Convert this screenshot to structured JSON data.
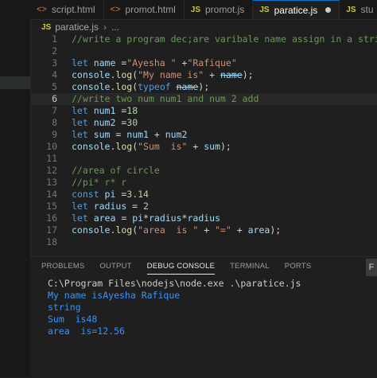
{
  "tabs": [
    {
      "label": "script.html",
      "icon": "html-icon",
      "active": false
    },
    {
      "label": "promot.html",
      "icon": "html-icon",
      "active": false
    },
    {
      "label": "promot.js",
      "icon": "js-icon",
      "active": false
    },
    {
      "label": "paratice.js",
      "icon": "js-icon",
      "active": true,
      "unsaved": true
    },
    {
      "label": "stu",
      "icon": "js-icon",
      "active": false
    }
  ],
  "breadcrumb": {
    "file": "paratice.js",
    "more": "..."
  },
  "editor": {
    "current_line": 6,
    "lines": [
      {
        "n": "1",
        "tokens": [
          {
            "t": "//write a program dec;are varibale name assign in a string",
            "c": "cm"
          }
        ]
      },
      {
        "n": "2",
        "tokens": []
      },
      {
        "n": "3",
        "tokens": [
          {
            "t": "let ",
            "c": "kw"
          },
          {
            "t": "name",
            "c": "vr"
          },
          {
            "t": " =",
            "c": "pl"
          },
          {
            "t": "\"Ayesha \"",
            "c": "st"
          },
          {
            "t": " +",
            "c": "pl"
          },
          {
            "t": "\"Rafique\"",
            "c": "st"
          }
        ]
      },
      {
        "n": "4",
        "tokens": [
          {
            "t": "console",
            "c": "vr"
          },
          {
            "t": ".",
            "c": "pl"
          },
          {
            "t": "log",
            "c": "fn"
          },
          {
            "t": "(",
            "c": "pl"
          },
          {
            "t": "\"My name is\"",
            "c": "st"
          },
          {
            "t": " + ",
            "c": "pl"
          },
          {
            "t": "name",
            "c": "vr",
            "s": true
          },
          {
            "t": ");",
            "c": "pl"
          }
        ]
      },
      {
        "n": "5",
        "tokens": [
          {
            "t": "console",
            "c": "vr"
          },
          {
            "t": ".",
            "c": "pl"
          },
          {
            "t": "log",
            "c": "fn"
          },
          {
            "t": "(",
            "c": "pl"
          },
          {
            "t": "typeof ",
            "c": "kw"
          },
          {
            "t": "name",
            "c": "vr",
            "s": true
          },
          {
            "t": ");",
            "c": "pl"
          }
        ]
      },
      {
        "n": "6",
        "tokens": [
          {
            "t": "//write two num num1 and num 2 add",
            "c": "cm"
          }
        ]
      },
      {
        "n": "7",
        "tokens": [
          {
            "t": "let ",
            "c": "kw"
          },
          {
            "t": "num1",
            "c": "vr"
          },
          {
            "t": " =",
            "c": "pl"
          },
          {
            "t": "18",
            "c": "nu"
          }
        ]
      },
      {
        "n": "8",
        "tokens": [
          {
            "t": "let ",
            "c": "kw"
          },
          {
            "t": "num2",
            "c": "vr"
          },
          {
            "t": " =",
            "c": "pl"
          },
          {
            "t": "30",
            "c": "nu"
          }
        ]
      },
      {
        "n": "9",
        "tokens": [
          {
            "t": "let ",
            "c": "kw"
          },
          {
            "t": "sum",
            "c": "vr"
          },
          {
            "t": " = ",
            "c": "pl"
          },
          {
            "t": "num1",
            "c": "vr"
          },
          {
            "t": " + ",
            "c": "pl"
          },
          {
            "t": "num2",
            "c": "vr"
          }
        ]
      },
      {
        "n": "10",
        "tokens": [
          {
            "t": "console",
            "c": "vr"
          },
          {
            "t": ".",
            "c": "pl"
          },
          {
            "t": "log",
            "c": "fn"
          },
          {
            "t": "(",
            "c": "pl"
          },
          {
            "t": "\"Sum  is\"",
            "c": "st"
          },
          {
            "t": " + ",
            "c": "pl"
          },
          {
            "t": "sum",
            "c": "vr"
          },
          {
            "t": ");",
            "c": "pl"
          }
        ]
      },
      {
        "n": "11",
        "tokens": []
      },
      {
        "n": "12",
        "tokens": [
          {
            "t": "//area of circle",
            "c": "cm"
          }
        ]
      },
      {
        "n": "13",
        "tokens": [
          {
            "t": "//pi* r* r",
            "c": "cm"
          }
        ]
      },
      {
        "n": "14",
        "tokens": [
          {
            "t": "const ",
            "c": "kw"
          },
          {
            "t": "pi",
            "c": "vr"
          },
          {
            "t": " =",
            "c": "pl"
          },
          {
            "t": "3.14",
            "c": "nu"
          }
        ]
      },
      {
        "n": "15",
        "tokens": [
          {
            "t": "let ",
            "c": "kw"
          },
          {
            "t": "radius",
            "c": "vr"
          },
          {
            "t": " = ",
            "c": "pl"
          },
          {
            "t": "2",
            "c": "nu"
          }
        ]
      },
      {
        "n": "16",
        "tokens": [
          {
            "t": "let ",
            "c": "kw"
          },
          {
            "t": "area",
            "c": "vr"
          },
          {
            "t": " = ",
            "c": "pl"
          },
          {
            "t": "pi",
            "c": "vr"
          },
          {
            "t": "*",
            "c": "pl"
          },
          {
            "t": "radius",
            "c": "vr"
          },
          {
            "t": "*",
            "c": "pl"
          },
          {
            "t": "radius",
            "c": "vr"
          }
        ]
      },
      {
        "n": "17",
        "tokens": [
          {
            "t": "console",
            "c": "vr"
          },
          {
            "t": ".",
            "c": "pl"
          },
          {
            "t": "log",
            "c": "fn"
          },
          {
            "t": "(",
            "c": "pl"
          },
          {
            "t": "\"area  is \"",
            "c": "st"
          },
          {
            "t": " + ",
            "c": "pl"
          },
          {
            "t": "\"=\"",
            "c": "st"
          },
          {
            "t": " + ",
            "c": "pl"
          },
          {
            "t": "area",
            "c": "vr"
          },
          {
            "t": ");",
            "c": "pl"
          }
        ]
      },
      {
        "n": "18",
        "tokens": []
      }
    ]
  },
  "panel": {
    "tabs": [
      "PROBLEMS",
      "OUTPUT",
      "DEBUG CONSOLE",
      "TERMINAL",
      "PORTS"
    ],
    "active_tab": "DEBUG CONSOLE",
    "filter_label": "F",
    "command": "C:\\Program Files\\nodejs\\node.exe .\\paratice.js",
    "output": [
      "My name isAyesha Rafique",
      "string",
      "Sum  is48",
      "area  is=12.56"
    ]
  },
  "colors": {
    "keyword": "#569cd6",
    "variable": "#9cdcfe",
    "string": "#ce9178",
    "function": "#dcdcaa",
    "comment": "#6a9955",
    "number": "#b5cea8",
    "output": "#3794ff",
    "accent": "#0078d4"
  }
}
